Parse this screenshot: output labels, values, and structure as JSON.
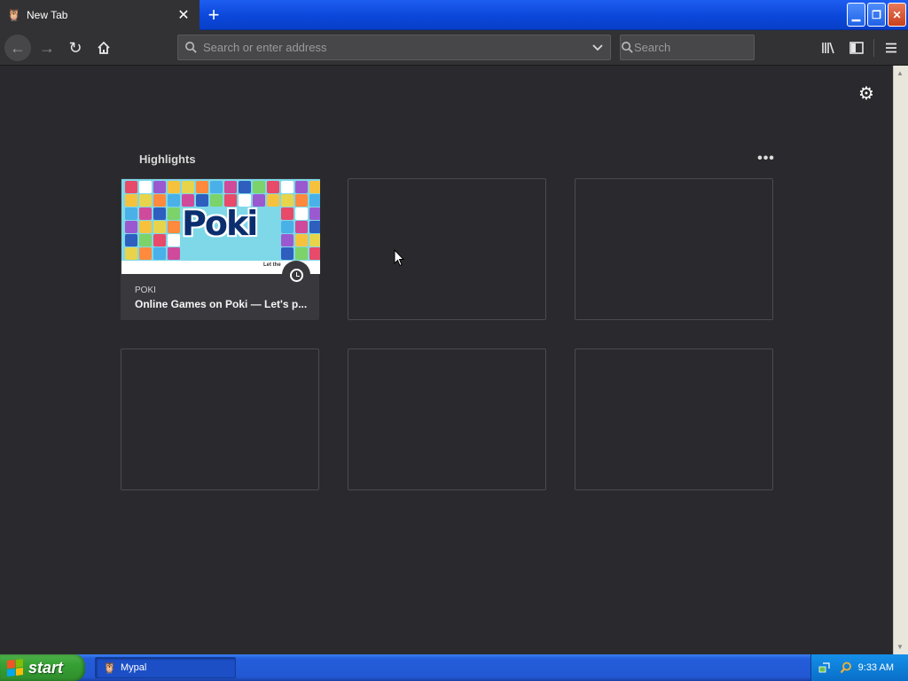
{
  "tab": {
    "title": "New Tab",
    "favicon": "mypal-favicon-icon"
  },
  "navbar": {
    "address_placeholder": "Search or enter address",
    "search_placeholder": "Search"
  },
  "highlights": {
    "title": "Highlights",
    "cards": [
      {
        "site": "POKI",
        "title": "Online Games on Poki — Let's p...",
        "thumbnail_logo": "Poki",
        "thumbnail_tagline": "Let the",
        "badge": "clock-icon"
      },
      {
        "site": "",
        "title": ""
      },
      {
        "site": "",
        "title": ""
      },
      {
        "site": "",
        "title": ""
      },
      {
        "site": "",
        "title": ""
      },
      {
        "site": "",
        "title": ""
      }
    ]
  },
  "taskbar": {
    "start_label": "start",
    "apps": [
      {
        "label": "Mypal"
      }
    ],
    "clock": "9:33 AM"
  },
  "colors": {
    "content_bg": "#2a2a2e",
    "toolbar_bg": "#323234",
    "xp_blue": "#245edb",
    "xp_green": "#36a033"
  }
}
